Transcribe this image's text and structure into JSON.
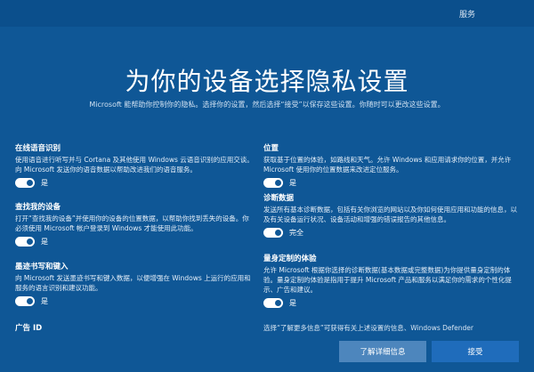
{
  "topbar": {
    "service": "服务"
  },
  "header": {
    "title": "为你的设备选择隐私设置",
    "subtitle": "Microsoft 能帮助你控制你的隐私。选择你的设置，然后选择“接受”以保存这些设置。你随时可以更改这些设置。"
  },
  "left": [
    {
      "title": "在线语音识别",
      "desc": "使用语音进行听写并与 Cortana 及其他使用 Windows 云语音识别的应用交谈。向 Microsoft 发送你的语音数据以帮助改进我们的语音服务。",
      "toggle": "是"
    },
    {
      "title": "查找我的设备",
      "desc": "打开“查找我的设备”并使用你的设备的位置数据，以帮助你找到丢失的设备。你必须使用 Microsoft 帐户登录到 Windows 才能使用此功能。",
      "toggle": "是"
    },
    {
      "title": "墨迹书写和键入",
      "desc": "向 Microsoft 发送墨迹书写和键入数据，以便增强在 Windows 上运行的应用和服务的语言识别和建议功能。",
      "toggle": "是"
    }
  ],
  "right": [
    {
      "title": "位置",
      "desc": "获取基于位置的体验，如路线和天气。允许 Windows 和应用请求你的位置，并允许 Microsoft 使用你的位置数据来改进定位服务。",
      "toggle": "是"
    },
    {
      "title": "诊断数据",
      "desc": "发送所有基本诊断数据，包括有关你浏览的网站以及你如何使用应用和功能的信息，以及有关设备运行状况、设备活动和增强的错误报告的其他信息。",
      "toggle": "完全"
    },
    {
      "title": "量身定制的体验",
      "desc": "允许 Microsoft 根据你选择的诊断数据(基本数据或完整数据)为你提供量身定制的体验。量身定制的体验是指用于提升 Microsoft 产品和服务以满足你的需求的个性化提示、广告和建议。",
      "toggle": "是"
    }
  ],
  "bottom": {
    "ad_id": "广告 ID",
    "clipped_text": "选择“了解更多信息”可获得有关上述设置的信息、Windows Defender",
    "more_button": "了解详细信息",
    "accept_button": "接受"
  }
}
